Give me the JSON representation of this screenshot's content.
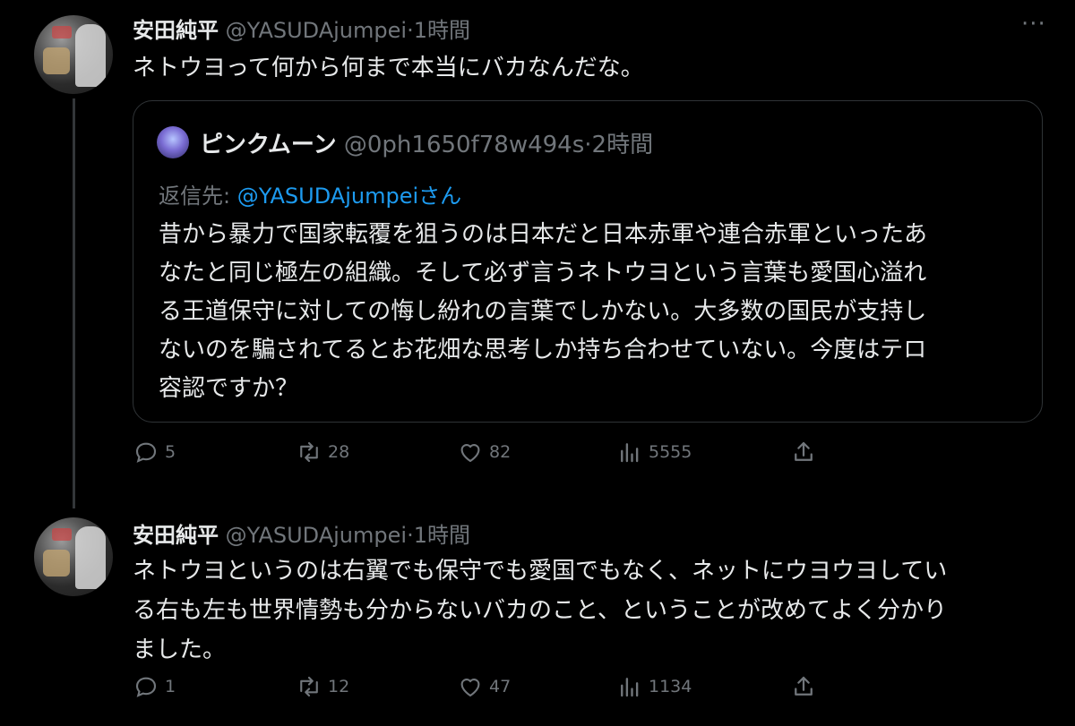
{
  "tweets": [
    {
      "author_name": "安田純平",
      "author_handle": "@YASUDAjumpei",
      "time": "·1時間",
      "more": "···",
      "text": "ネトウヨって何から何まで本当にバカなんだな。",
      "quote": {
        "author_name": "ピンクムーン",
        "author_handle": "@0ph1650f78w494s",
        "time": "·2時間",
        "reply_prefix": "返信先: ",
        "reply_mention": "@YASUDAjumpei",
        "reply_suffix": "さん",
        "text_lines": [
          "昔から暴力で国家転覆を狙うのは日本だと日本赤軍や連合赤軍といったあ",
          "なたと同じ極左の組織。そして必ず言うネトウヨという言葉も愛国心溢れ",
          "る王道保守に対しての悔し紛れの言葉でしかない。大多数の国民が支持し",
          "ないのを騙されてるとお花畑な思考しか持ち合わせていない。今度はテロ",
          "容認ですか？"
        ]
      },
      "stats": {
        "replies": "5",
        "retweets": "28",
        "likes": "82",
        "views": "5555"
      }
    },
    {
      "author_name": "安田純平",
      "author_handle": "@YASUDAjumpei",
      "time": "·1時間",
      "text_lines": [
        "ネトウヨというのは右翼でも保守でも愛国でもなく、ネットにウヨウヨしてい",
        "る右も左も世界情勢も分からないバカのこと、ということが改めてよく分かり",
        "ました。"
      ],
      "stats": {
        "replies": "1",
        "retweets": "12",
        "likes": "47",
        "views": "1134"
      }
    }
  ],
  "icons": [
    "reply-icon",
    "retweet-icon",
    "like-icon",
    "views-icon",
    "share-icon",
    "more-icon"
  ],
  "colors": {
    "background": "#000000",
    "text": "#e7e9ea",
    "muted": "#71767b",
    "link": "#1d9bf0",
    "border": "#2f3336"
  }
}
